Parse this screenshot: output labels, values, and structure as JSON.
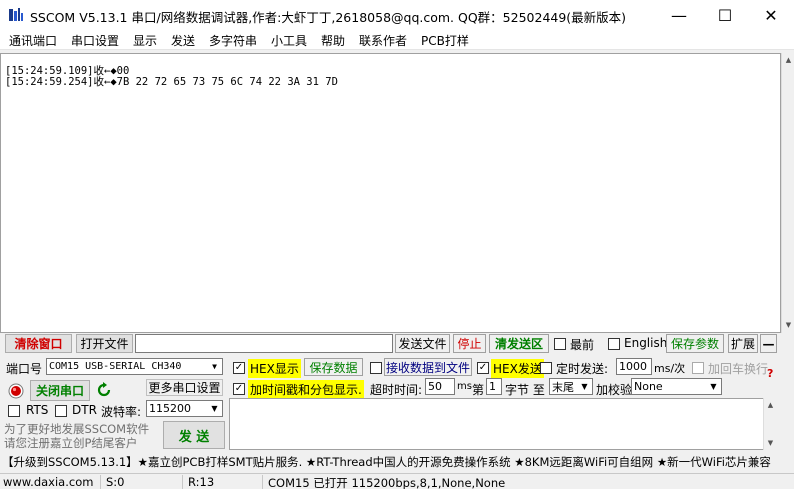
{
  "window": {
    "title": "SSCOM V5.13.1 串口/网络数据调试器,作者:大虾丁丁,2618058@qq.com. QQ群：52502449(最新版本)",
    "minimize": "—",
    "maximize": "☐",
    "close": "✕"
  },
  "menu": [
    "通讯端口",
    "串口设置",
    "显示",
    "发送",
    "多字符串",
    "小工具",
    "帮助",
    "联系作者",
    "PCB打样"
  ],
  "receive": {
    "lines": [
      "[15:24:59.109]收←◆00",
      "[15:24:59.254]收←◆7B 22 72 65 73 75 6C 74 22 3A 31 7D"
    ]
  },
  "toolbar1": {
    "clear_window": "清除窗口",
    "open_file": "打开文件",
    "file_path": "",
    "send_file": "发送文件",
    "stop": "停止",
    "clear_send": "清发送区",
    "topmost": "最前",
    "english": "English",
    "save_params": "保存参数",
    "expand": "扩展",
    "collapse": "—"
  },
  "port": {
    "label": "端口号",
    "selected": "COM15 USB-SERIAL CH340",
    "close_port": "关闭串口",
    "more_settings": "更多串口设置",
    "rts": "RTS",
    "dtr": "DTR",
    "baud_label": "波特率:",
    "baud": "115200"
  },
  "options": {
    "hex_display": "HEX显示",
    "save_data": "保存数据",
    "recv_to_file": "接收数据到文件",
    "hex_send": "HEX发送",
    "timed_send": "定时发送:",
    "interval": "1000",
    "interval_unit": "ms/次",
    "append_newline": "加回车换行",
    "add_timestamp": "加时间戳和分包显示.",
    "timeout_label": "超时时间:",
    "timeout": "50",
    "timeout_unit": "ms",
    "nth_label": "第",
    "nth": "1",
    "byte_to": "字节 至",
    "end": "末尾",
    "checksum_label": "加校验",
    "checksum": "None",
    "help_mark": "?"
  },
  "promo": {
    "line1": "为了更好地发展SSCOM软件",
    "line2": "请您注册嘉立创P结尾客户"
  },
  "send_button": "发 送",
  "ticker": "【升级到SSCOM5.13.1】★嘉立创PCB打样SMT贴片服务. ★RT-Thread中国人的开源免费操作系统 ★8KM远距离WiFi可自组网 ★新一代WiFi芯片兼容",
  "status": {
    "website": "www.daxia.com",
    "sent": "S:0",
    "received": "R:13",
    "port_state": "COM15 已打开  115200bps,8,1,None,None"
  },
  "colors": {
    "accent_red": "#d00000",
    "accent_green": "#008000",
    "highlight": "#ffff00"
  }
}
